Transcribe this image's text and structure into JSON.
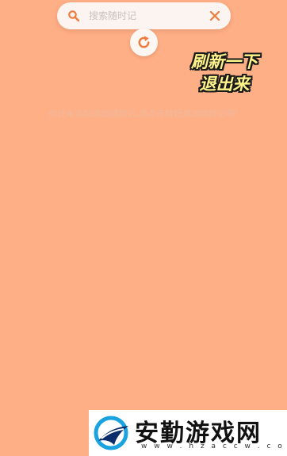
{
  "search": {
    "placeholder": "搜索随时记",
    "value": ""
  },
  "annotation": {
    "line1": "刷新一下",
    "line2": "退出来"
  },
  "empty_state": {
    "message": "你还未添加添加随时记,请点击按钮添加随时记吧!"
  },
  "watermark": {
    "title": "安勤游戏网",
    "url": "w w w . h z a c c w . c o m"
  },
  "colors": {
    "background": "#ffaf86",
    "accent": "#f07b3f"
  },
  "icons": {
    "search": "search-icon",
    "clear": "close-icon",
    "refresh": "refresh-icon"
  }
}
